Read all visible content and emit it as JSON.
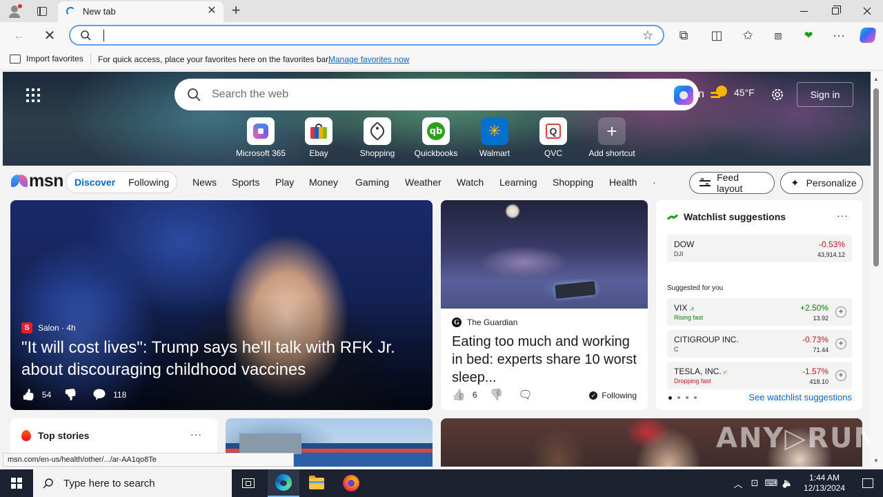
{
  "browser": {
    "tab_title": "New tab",
    "tab_close_glyph": "✕",
    "new_tab_glyph": "+",
    "address_value": "",
    "icons": [
      "profile-icon",
      "tab-actions-icon",
      "loading-spinner-icon",
      "back-arrow-icon",
      "stop-icon",
      "search-icon",
      "star-icon",
      "extensions-icon",
      "split-screen-icon",
      "favorites-icon",
      "collections-icon",
      "performance-icon",
      "more-icon",
      "copilot-icon"
    ],
    "back_glyph": "←",
    "stop_glyph": "✕",
    "star_glyph": "☆",
    "toolbar_glyphs": {
      "extensions": "⧉",
      "split": "◫",
      "favorites": "✩",
      "collections": "⧈",
      "performance": "❤",
      "more": "···"
    }
  },
  "favorites_bar": {
    "import_label": "Import favorites",
    "message": "For quick access, place your favorites here on the favorites bar.",
    "manage_link": "Manage favorites now"
  },
  "msn_hero": {
    "search_placeholder": "Search the web",
    "partial_text": "n",
    "weather_temp": "45°F",
    "sign_in": "Sign in",
    "settings_glyph": "⚙",
    "shortcuts": [
      {
        "label": "Microsoft 365",
        "icon": "microsoft-365-icon"
      },
      {
        "label": "Ebay",
        "icon": "ebay-icon"
      },
      {
        "label": "Shopping",
        "icon": "shopping-tag-icon"
      },
      {
        "label": "Quickbooks",
        "icon": "quickbooks-icon",
        "glyph": "qb"
      },
      {
        "label": "Walmart",
        "icon": "walmart-icon",
        "glyph": "✳"
      },
      {
        "label": "QVC",
        "icon": "qvc-icon",
        "glyph": "Q"
      },
      {
        "label": "Add shortcut",
        "icon": "plus-icon",
        "glyph": "+"
      }
    ]
  },
  "msn_nav": {
    "logo_text": "msn",
    "feed_tabs": {
      "discover": "Discover",
      "following": "Following"
    },
    "categories": [
      "News",
      "Sports",
      "Play",
      "Money",
      "Gaming",
      "Weather",
      "Watch",
      "Learning",
      "Shopping",
      "Health",
      "·"
    ],
    "feed_layout": "Feed layout",
    "personalize": "Personalize",
    "sparkle_glyph": "✦"
  },
  "hero_article": {
    "source_logo": "S",
    "source": "Salon · 4h",
    "title": "\"It will cost lives\": Trump says he'll talk with RFK Jr. about discouraging childhood vaccines",
    "likes": "54",
    "comments": "118",
    "like_glyph": "👍",
    "dislike_glyph": "👎",
    "comment_glyph": "💬"
  },
  "guardian_article": {
    "source_logo": "G",
    "source": "The Guardian",
    "title": "Eating too much and working in bed: experts share 10 worst sleep...",
    "likes": "6",
    "following": "Following",
    "check_glyph": "✓",
    "like_glyph": "👍",
    "dislike_glyph": "👎",
    "comment_glyph": "🗨"
  },
  "watchlist": {
    "title": "Watchlist suggestions",
    "more_glyph": "···",
    "primary": {
      "name": "DOW",
      "sub": "DJI",
      "change": "-0.53%",
      "price": "43,914.12"
    },
    "suggested_label": "Suggested for you",
    "suggestions": [
      {
        "name": "VIX",
        "sub": "Rising fast",
        "change": "+2.50%",
        "price": "13.92",
        "direction": "pos"
      },
      {
        "name": "CITIGROUP INC.",
        "sub": "C",
        "change": "-0.73%",
        "price": "71.44",
        "direction": "neg"
      },
      {
        "name": "TESLA, INC.",
        "sub": "Dropping fast",
        "change": "-1.57%",
        "price": "418.10",
        "direction": "neg"
      }
    ],
    "add_glyph": "+",
    "link": "See watchlist suggestions",
    "colors": {
      "negative": "#c50f1f",
      "positive": "#0e7a0d"
    }
  },
  "top_stories": {
    "title": "Top stories",
    "more_glyph": "···"
  },
  "watermark": "ANY▷RUN",
  "status_url": "msn.com/en-us/health/other/.../ar-AA1qo8Te",
  "scrollbar": {
    "up_glyph": "▲",
    "down_glyph": "▼"
  },
  "taskbar": {
    "search_placeholder": "Type here to search",
    "time": "1:44 AM",
    "date": "12/13/2024",
    "tray_glyphs": {
      "chevron": "︿",
      "network": "⊡",
      "speaker": "🔈",
      "wifi": "⌨"
    }
  }
}
